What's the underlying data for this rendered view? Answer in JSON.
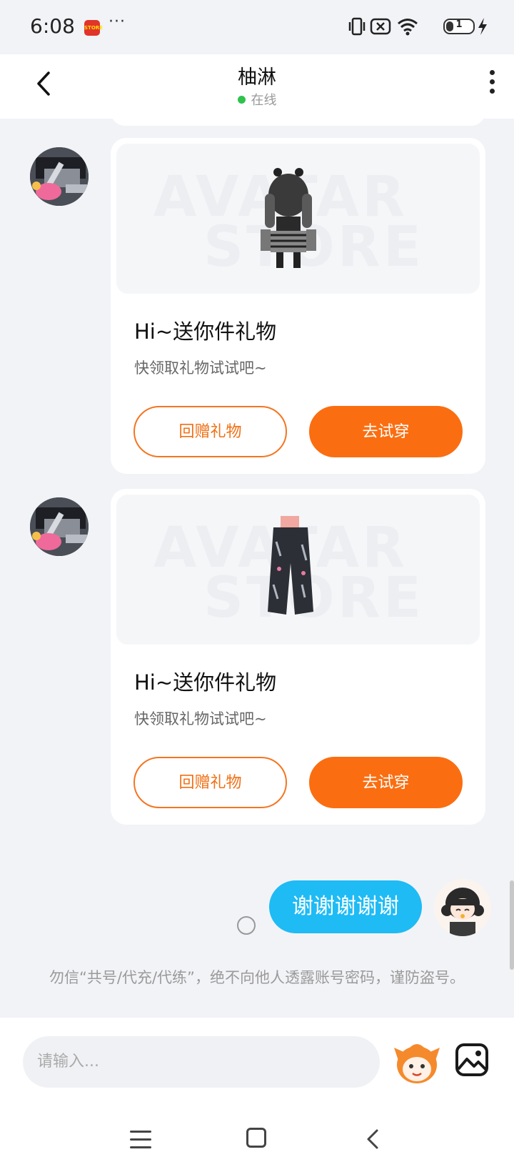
{
  "status_bar": {
    "time": "6:08",
    "app_badge_text": "STORE",
    "more_dots": "···",
    "battery_level": "1"
  },
  "header": {
    "title": "柚淋",
    "status": "在线",
    "online_color": "#2fc24d"
  },
  "gift_cards": [
    {
      "title": "Hi~送你件礼物",
      "subtitle": "快领取礼物试试吧~",
      "return_gift_label": "回赠礼物",
      "try_on_label": "去试穿",
      "watermark_top": "AVATAR",
      "watermark_bottom": "STORE"
    },
    {
      "title": "Hi~送你件礼物",
      "subtitle": "快领取礼物试试吧~",
      "return_gift_label": "回赠礼物",
      "try_on_label": "去试穿",
      "watermark_top": "AVATAR",
      "watermark_bottom": "STORE"
    }
  ],
  "my_message": {
    "text": "谢谢谢谢谢"
  },
  "notice": "勿信“共号/代充/代练”，绝不向他人透露账号密码，谨防盗号。",
  "input": {
    "placeholder": "请输入..."
  },
  "colors": {
    "accent_orange": "#fa6e11",
    "bubble_blue": "#1ebbf5",
    "background": "#f2f3f7"
  },
  "icons": [
    "back-icon",
    "more-vertical-icon",
    "emoji-icon",
    "image-icon",
    "menu-icon",
    "home-icon",
    "back-nav-icon"
  ]
}
